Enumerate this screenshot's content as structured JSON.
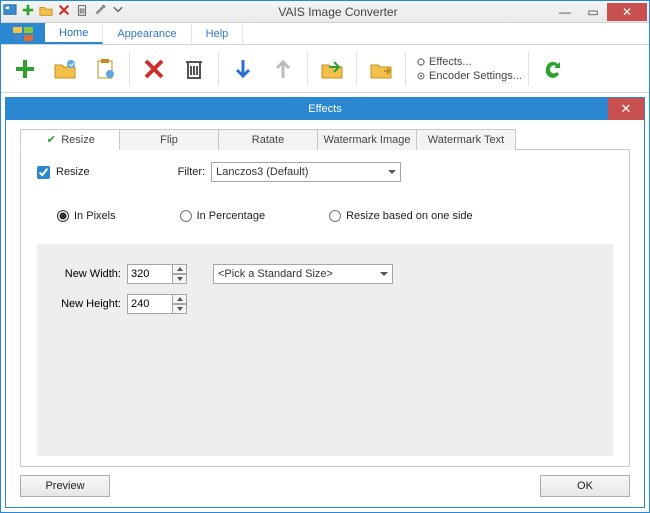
{
  "window": {
    "title": "VAIS Image Converter"
  },
  "tabs": {
    "home": "Home",
    "appearance": "Appearance",
    "help": "Help"
  },
  "ribbon": {
    "effects": "Effects...",
    "encoder": "Encoder Settings..."
  },
  "dialog": {
    "title": "Effects",
    "tabs": {
      "resize": "Resize",
      "flip": "Flip",
      "rotate": "Ratate",
      "wmimg": "Watermark Image",
      "wmtxt": "Watermark Text"
    },
    "resize": {
      "check_label": "Resize",
      "checked": true,
      "filter_label": "Filter:",
      "filter_value": "Lanczos3 (Default)",
      "mode": {
        "pixels": "In Pixels",
        "percent": "In Percentage",
        "oneside": "Resize based on one side",
        "selected": "pixels"
      },
      "width_label": "New Width:",
      "width_value": "320",
      "height_label": "New Height:",
      "height_value": "240",
      "std_size": "<Pick a Standard Size>"
    },
    "buttons": {
      "preview": "Preview",
      "ok": "OK"
    }
  }
}
